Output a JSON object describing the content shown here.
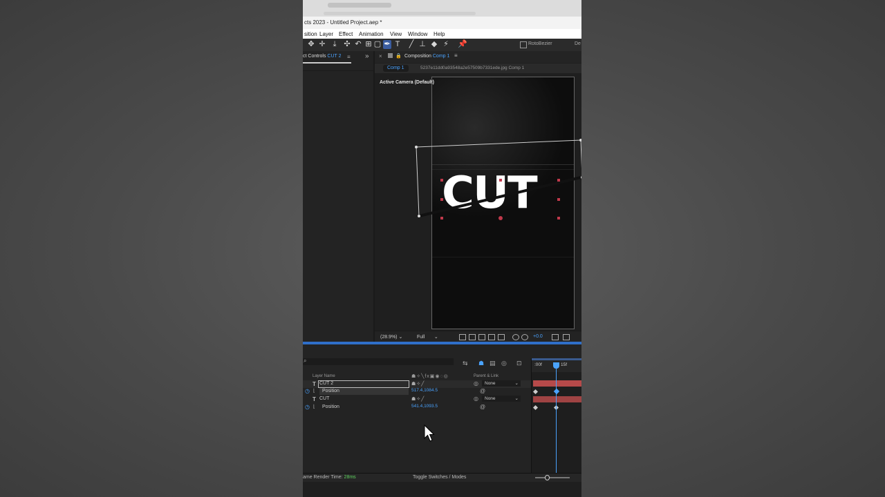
{
  "window": {
    "title": "cts 2023 - Untitled Project.aep *"
  },
  "menu": [
    "sition",
    "Layer",
    "Effect",
    "Animation",
    "View",
    "Window",
    "Help"
  ],
  "toolbar": {
    "rotobezier_label": "RotoBezier",
    "trailing_label": "De"
  },
  "effect_controls": {
    "tab_label": "ct Controls",
    "layer_name": "CUT 2"
  },
  "composition": {
    "tab_prefix": "Composition",
    "tab_name": "Comp 1",
    "crumb_active": "Comp 1",
    "crumb_path": "5237e11dd0a93548a2e57509b7331ede.jpg Comp 1",
    "camera_label": "Active Camera (Default)",
    "canvas_text": "CUT",
    "zoom": "(28.9%)",
    "resolution": "Full",
    "exposure": "+0.0"
  },
  "timeline": {
    "header": {
      "layer_name": "Layer Name",
      "parent_link": "Parent & Link"
    },
    "rows": [
      {
        "type": "layer",
        "name": "CUT 2",
        "parent": "None",
        "selected": true
      },
      {
        "type": "prop",
        "name": "Position",
        "value": "517.4,1084.5"
      },
      {
        "type": "layer",
        "name": "CUT",
        "parent": "None",
        "selected": false
      },
      {
        "type": "prop",
        "name": "Position",
        "value": "541.4,1093.5"
      }
    ],
    "ruler": {
      "start": ":00f",
      "mark": "15f"
    }
  },
  "status": {
    "render_label": "ame Render Time:",
    "render_value": "28ms",
    "toggle_label": "Toggle Switches / Modes"
  },
  "colors": {
    "accent": "#4aa3ff",
    "layer_bar": "#b64a4a",
    "panel_bg": "#232323",
    "render_ok": "#5fd35f"
  }
}
